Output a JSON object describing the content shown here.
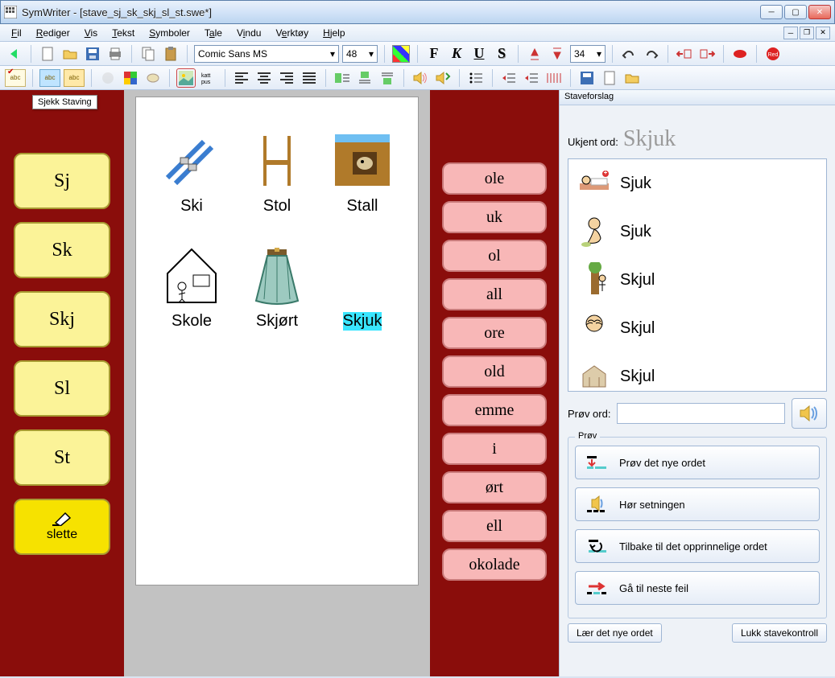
{
  "window": {
    "title": "SymWriter - [stave_sj_sk_skj_sl_st.swe*]"
  },
  "menu": {
    "items": [
      "Fil",
      "Rediger",
      "Vis",
      "Tekst",
      "Symboler",
      "Tale",
      "Vindu",
      "Verktøy",
      "Hjelp"
    ]
  },
  "toolbar": {
    "font_name": "Comic Sans MS",
    "font_size": "48",
    "sym_size": "34"
  },
  "tooltip": "Sjekk Staving",
  "left_buttons": [
    "Sj",
    "Sk",
    "Skj",
    "Sl",
    "St"
  ],
  "slette_label": "slette",
  "document": {
    "row1": [
      {
        "label": "Ski"
      },
      {
        "label": "Stol"
      },
      {
        "label": "Stall"
      }
    ],
    "row2": [
      {
        "label": "Skole"
      },
      {
        "label": "Skjørt"
      },
      {
        "label": "Skjuk",
        "highlight": true
      }
    ]
  },
  "right_buttons": [
    "ole",
    "uk",
    "ol",
    "all",
    "ore",
    "old",
    "emme",
    "i",
    "ørt",
    "ell",
    "okolade"
  ],
  "spell": {
    "panel_title": "Staveforslag",
    "unknown_label": "Ukjent ord:",
    "unknown_word": "Skjuk",
    "suggestions": [
      "Sjuk",
      "Sjuk",
      "Skjul",
      "Skjul",
      "Skjul"
    ],
    "try_label": "Prøv ord:",
    "try_value": "",
    "fieldset_label": "Prøv",
    "actions": {
      "try_new": "Prøv det nye ordet",
      "hear": "Hør setningen",
      "back": "Tilbake til det opprinnelige ordet",
      "next": "Gå til neste feil"
    },
    "learn": "Lær det nye ordet",
    "close": "Lukk stavekontroll"
  }
}
